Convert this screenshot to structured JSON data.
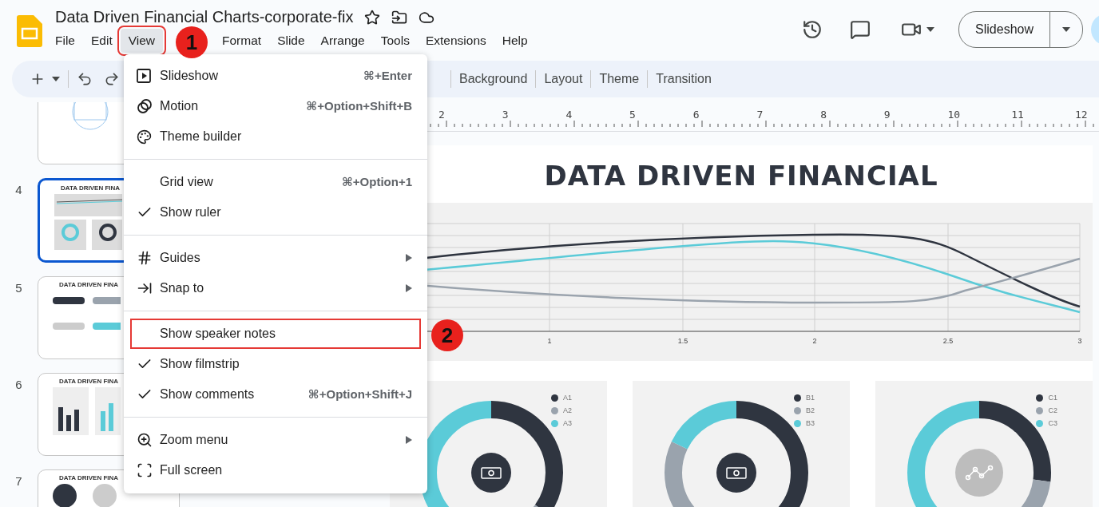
{
  "document": {
    "title": "Data Driven Financial Charts-corporate-fix"
  },
  "menubar": [
    {
      "label": "File",
      "selected": false
    },
    {
      "label": "Edit",
      "selected": false
    },
    {
      "label": "View",
      "selected": true
    },
    {
      "label": "Format",
      "selected": false
    },
    {
      "label": "Slide",
      "selected": false
    },
    {
      "label": "Arrange",
      "selected": false
    },
    {
      "label": "Tools",
      "selected": false
    },
    {
      "label": "Extensions",
      "selected": false
    },
    {
      "label": "Help",
      "selected": false
    }
  ],
  "header_actions": {
    "slideshow_button": "Slideshow"
  },
  "toolbar": {
    "buttons": [
      "Background",
      "Layout",
      "Theme",
      "Transition"
    ]
  },
  "filmstrip": [
    {
      "selected": false
    },
    {
      "number": "4",
      "title": "DATA DRIVEN FINA",
      "selected": true
    },
    {
      "number": "5",
      "title": "DATA DRIVEN FINA",
      "selected": false
    },
    {
      "number": "6",
      "title": "DATA DRIVEN FINA",
      "selected": false
    },
    {
      "number": "7",
      "title": "DATA DRIVEN FINA",
      "selected": false
    }
  ],
  "ruler": [
    "2",
    "3",
    "4",
    "5",
    "6",
    "7",
    "8",
    "9",
    "10",
    "11",
    "12"
  ],
  "slide": {
    "title": "DATA DRIVEN FINANCIAL",
    "line_chart": {
      "x_labels": [
        "1",
        "1.5",
        "2",
        "2.5",
        "3"
      ]
    },
    "donut_cards": [
      {
        "legend": [
          {
            "label": "A1",
            "color": "#2f3540"
          },
          {
            "label": "A2",
            "color": "#9aa3ad"
          },
          {
            "label": "A3",
            "color": "#5bcbd8"
          }
        ]
      },
      {
        "legend": [
          {
            "label": "B1",
            "color": "#2f3540"
          },
          {
            "label": "B2",
            "color": "#9aa3ad"
          },
          {
            "label": "B3",
            "color": "#5bcbd8"
          }
        ]
      },
      {
        "legend": [
          {
            "label": "C1",
            "color": "#2f3540"
          },
          {
            "label": "C2",
            "color": "#9aa3ad"
          },
          {
            "label": "C3",
            "color": "#5bcbd8"
          }
        ]
      }
    ]
  },
  "view_menu": {
    "groups": [
      [
        {
          "label": "Slideshow",
          "shortcut": "⌘+Enter",
          "checked": false,
          "submenu": false,
          "highlighted": false
        },
        {
          "label": "Motion",
          "shortcut": "⌘+Option+Shift+B",
          "checked": false,
          "submenu": false,
          "highlighted": false
        },
        {
          "label": "Theme builder",
          "checked": false,
          "submenu": false,
          "highlighted": false
        }
      ],
      [
        {
          "label": "Grid view",
          "shortcut": "⌘+Option+1",
          "checked": false,
          "submenu": false,
          "highlighted": false
        },
        {
          "label": "Show ruler",
          "checked": true,
          "submenu": false,
          "highlighted": false
        }
      ],
      [
        {
          "label": "Guides",
          "checked": false,
          "submenu": true,
          "highlighted": false
        },
        {
          "label": "Snap to",
          "checked": false,
          "submenu": true,
          "highlighted": false
        }
      ],
      [
        {
          "label": "Show speaker notes",
          "checked": false,
          "submenu": false,
          "highlighted": true
        },
        {
          "label": "Show filmstrip",
          "checked": true,
          "submenu": false,
          "highlighted": false
        },
        {
          "label": "Show comments",
          "shortcut": "⌘+Option+Shift+J",
          "checked": true,
          "submenu": false,
          "highlighted": false
        }
      ],
      [
        {
          "label": "Zoom menu",
          "checked": false,
          "submenu": true,
          "highlighted": false
        },
        {
          "label": "Full screen",
          "checked": false,
          "submenu": false,
          "highlighted": false
        }
      ]
    ]
  },
  "annotations": [
    {
      "label": "1"
    },
    {
      "label": "2"
    }
  ]
}
